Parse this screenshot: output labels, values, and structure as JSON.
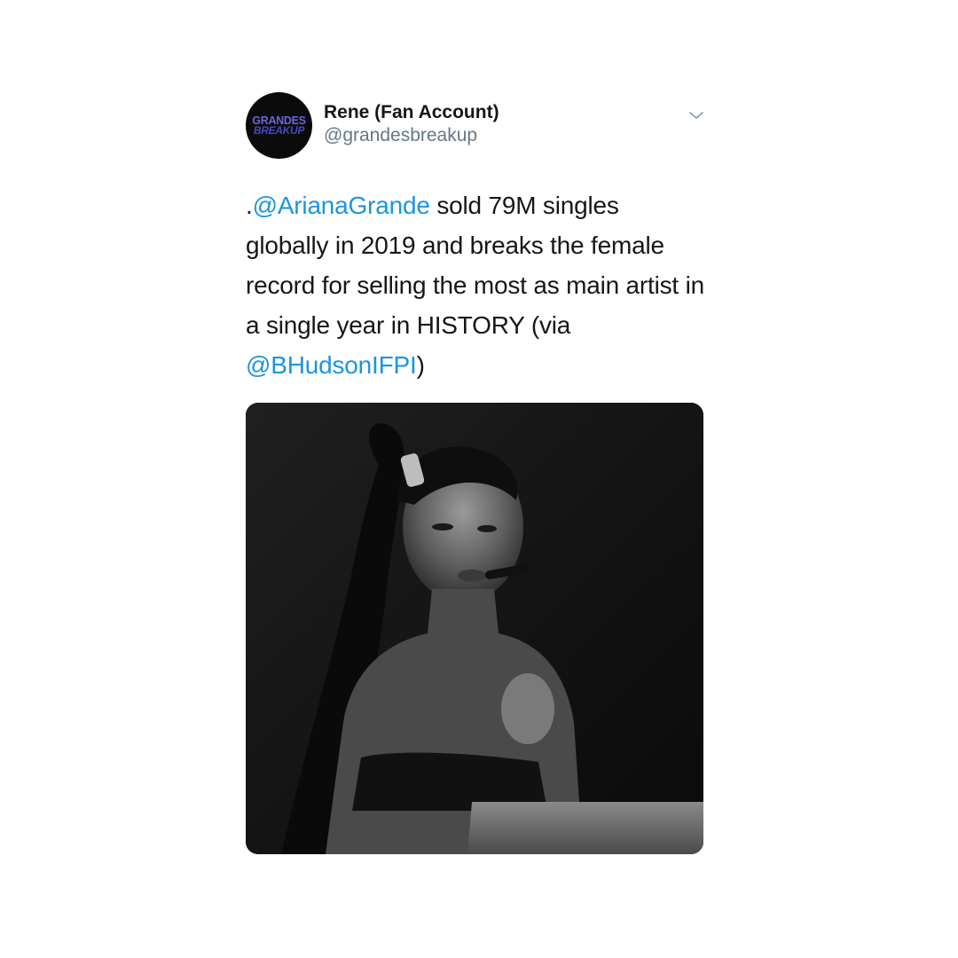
{
  "tweet": {
    "avatar": {
      "line1": "GRANDES",
      "line2": "BREAKUP"
    },
    "display_name": "Rene (Fan Account)",
    "handle": "@grandesbreakup",
    "text": {
      "prefix": ".",
      "mention1": "@ArianaGrande",
      "body": " sold 79M singles globally in 2019 and breaks the female record for selling the most as main artist in a single year in HISTORY (via ",
      "mention2": "@BHudsonIFPI",
      "suffix": ")"
    }
  },
  "colors": {
    "link": "#1b95e0",
    "text": "#14171a",
    "secondary": "#657786"
  },
  "icons": {
    "menu": "chevron-down-icon"
  }
}
